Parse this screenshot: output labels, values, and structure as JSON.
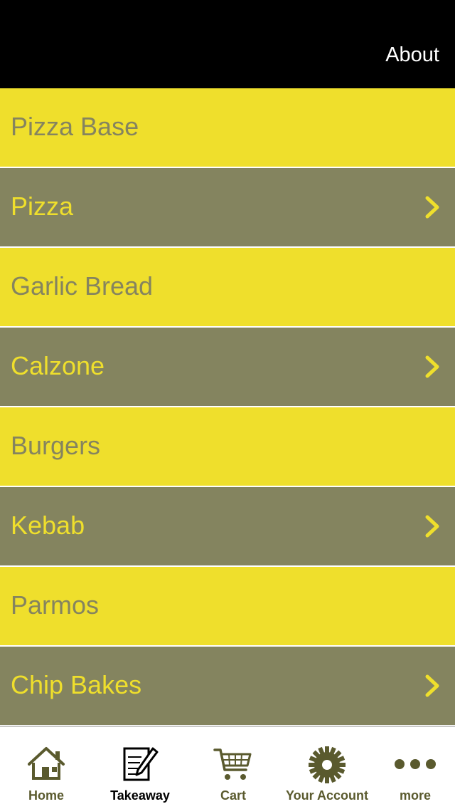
{
  "header": {
    "about_label": "About"
  },
  "menu": {
    "items": [
      {
        "label": "Pizza Base"
      },
      {
        "label": "Pizza"
      },
      {
        "label": "Garlic Bread"
      },
      {
        "label": "Calzone"
      },
      {
        "label": "Burgers"
      },
      {
        "label": "Kebab"
      },
      {
        "label": "Parmos"
      },
      {
        "label": "Chip Bakes"
      }
    ]
  },
  "tabs": [
    {
      "label": "Home",
      "icon": "home-icon"
    },
    {
      "label": "Takeaway",
      "icon": "notepad-pen-icon"
    },
    {
      "label": "Cart",
      "icon": "cart-icon"
    },
    {
      "label": "Your Account",
      "icon": "gear-icon"
    },
    {
      "label": "more",
      "icon": "more-dots-icon"
    }
  ],
  "colors": {
    "yellow": "#efdf2c",
    "olive": "#84845f",
    "tab_icon": "#5a5a2e",
    "header": "#000000"
  }
}
